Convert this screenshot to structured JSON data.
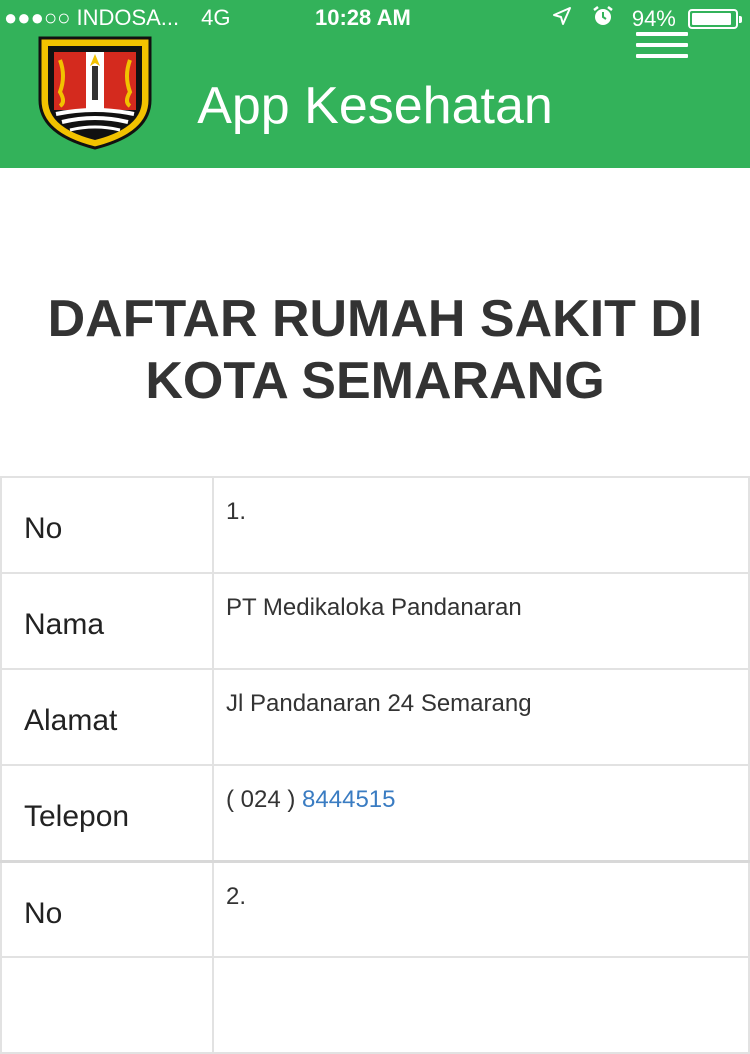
{
  "status_bar": {
    "signal": "●●●○○",
    "carrier": "INDOSA...",
    "network": "4G",
    "time": "10:28 AM",
    "battery": "94%",
    "battery_level": 0.94
  },
  "header": {
    "title": "App Kesehatan"
  },
  "page": {
    "heading": "DAFTAR RUMAH SAKIT DI KOTA SEMARANG"
  },
  "hospitals": [
    {
      "no_label": "No",
      "no": "1.",
      "nama_label": "Nama",
      "nama": "PT Medikaloka Pandanaran",
      "alamat_label": "Alamat",
      "alamat": "Jl Pandanaran 24 Semarang",
      "telepon_label": "Telepon",
      "telepon_prefix": "( 024 )",
      "telepon_number": "8444515"
    },
    {
      "no_label": "No",
      "no": "2."
    }
  ],
  "colors": {
    "header_bg": "#33b25a",
    "link": "#3a7cc2",
    "text": "#333333"
  },
  "icons": {
    "location": "location-arrow-icon",
    "alarm": "alarm-clock-icon",
    "menu": "hamburger-menu-icon"
  }
}
